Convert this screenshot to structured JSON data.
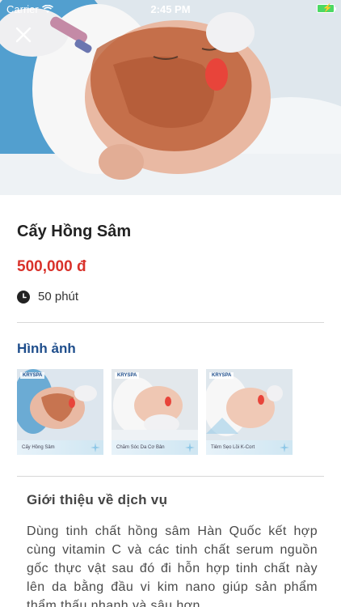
{
  "status_bar": {
    "carrier": "Carrier",
    "time": "2:45 PM"
  },
  "service": {
    "title": "Cấy Hồng Sâm",
    "price": "500,000 đ",
    "duration": "50 phút"
  },
  "gallery": {
    "heading": "Hình ảnh",
    "items": [
      {
        "caption": "Cấy Hồng Sâm",
        "logo": "KRYSPA"
      },
      {
        "caption": "Chăm Sóc Da Cơ Bản",
        "logo": "KRYSPA"
      },
      {
        "caption": "Tiêm Sẹo Lồi K-Cort",
        "logo": "KRYSPA"
      }
    ]
  },
  "intro": {
    "heading": "Giới thiệu về dịch vụ",
    "body": "Dùng tinh chất hồng sâm Hàn Quốc kết hợp cùng vitamin C và các tinh chất serum nguồn gốc thực vật sau đó đi hỗn hợp tinh chất này lên da bằng đầu vi kim nano giúp sản phẩm thẩm thấu nhanh và sâu hơn."
  },
  "icons": {
    "close": "close-icon",
    "clock": "clock-icon",
    "wifi": "wifi-icon",
    "battery": "battery-icon"
  },
  "colors": {
    "price": "#d9322b",
    "section_heading": "#1f4e8c",
    "battery": "#4cd964"
  }
}
